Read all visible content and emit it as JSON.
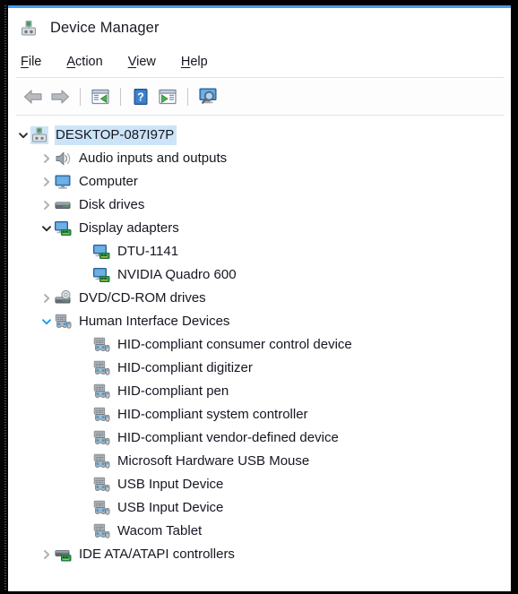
{
  "window": {
    "title": "Device Manager",
    "title_icon": "device-manager-icon",
    "accent_color": "#4a9ae8",
    "selection_color": "#cce4f7",
    "text_color": "#161622"
  },
  "menubar": {
    "items": [
      {
        "label": "File",
        "accel": "F",
        "name": "menu-file"
      },
      {
        "label": "Action",
        "accel": "A",
        "name": "menu-action"
      },
      {
        "label": "View",
        "accel": "V",
        "name": "menu-view"
      },
      {
        "label": "Help",
        "accel": "H",
        "name": "menu-help"
      }
    ]
  },
  "toolbar": {
    "buttons": [
      {
        "icon": "back-arrow-icon",
        "tooltip": "Back"
      },
      {
        "icon": "forward-arrow-icon",
        "tooltip": "Forward"
      },
      {
        "icon": "separator",
        "tooltip": ""
      },
      {
        "icon": "show-console-tree-icon",
        "tooltip": "Show/Hide console tree"
      },
      {
        "icon": "separator",
        "tooltip": ""
      },
      {
        "icon": "help-icon",
        "tooltip": "Help"
      },
      {
        "icon": "properties-icon",
        "tooltip": "Properties"
      },
      {
        "icon": "separator",
        "tooltip": ""
      },
      {
        "icon": "scan-hardware-icon",
        "tooltip": "Scan for hardware changes"
      }
    ]
  },
  "tree": {
    "rows": [
      {
        "label": "DESKTOP-087I97P",
        "level": 0,
        "chevron": "down",
        "chevron_color": "dark",
        "icon": "computer-root-icon",
        "selected": true,
        "name": "tree-item-desktop-087i97p"
      },
      {
        "label": "Audio inputs and outputs",
        "level": 1,
        "chevron": "right",
        "chevron_color": "gray",
        "icon": "speaker-icon",
        "selected": false,
        "name": "tree-item-audio-inputs-and-outputs"
      },
      {
        "label": "Computer",
        "level": 1,
        "chevron": "right",
        "chevron_color": "gray",
        "icon": "monitor-icon",
        "selected": false,
        "name": "tree-item-computer"
      },
      {
        "label": "Disk drives",
        "level": 1,
        "chevron": "right",
        "chevron_color": "gray",
        "icon": "disk-drive-icon",
        "selected": false,
        "name": "tree-item-disk-drives"
      },
      {
        "label": "Display adapters",
        "level": 1,
        "chevron": "down",
        "chevron_color": "dark",
        "icon": "display-adapter-icon",
        "selected": false,
        "name": "tree-item-display-adapters"
      },
      {
        "label": "DTU-1141",
        "level": 2,
        "chevron": "none",
        "chevron_color": "",
        "icon": "display-adapter-icon",
        "selected": false,
        "name": "tree-item-dtu-1141"
      },
      {
        "label": "NVIDIA Quadro 600",
        "level": 2,
        "chevron": "none",
        "chevron_color": "",
        "icon": "display-adapter-icon",
        "selected": false,
        "name": "tree-item-nvidia-quadro-600"
      },
      {
        "label": "DVD/CD-ROM drives",
        "level": 1,
        "chevron": "right",
        "chevron_color": "gray",
        "icon": "dvd-drive-icon",
        "selected": false,
        "name": "tree-item-dvd-cd-rom-drives"
      },
      {
        "label": "Human Interface Devices",
        "level": 1,
        "chevron": "down",
        "chevron_color": "blue",
        "icon": "hid-icon",
        "selected": false,
        "name": "tree-item-human-interface-devices"
      },
      {
        "label": "HID-compliant consumer control device",
        "level": 2,
        "chevron": "none",
        "chevron_color": "",
        "icon": "hid-icon",
        "selected": false,
        "name": "tree-item-hid-compliant-consumer-control-device"
      },
      {
        "label": "HID-compliant digitizer",
        "level": 2,
        "chevron": "none",
        "chevron_color": "",
        "icon": "hid-icon",
        "selected": false,
        "name": "tree-item-hid-compliant-digitizer"
      },
      {
        "label": "HID-compliant pen",
        "level": 2,
        "chevron": "none",
        "chevron_color": "",
        "icon": "hid-icon",
        "selected": false,
        "name": "tree-item-hid-compliant-pen"
      },
      {
        "label": "HID-compliant system controller",
        "level": 2,
        "chevron": "none",
        "chevron_color": "",
        "icon": "hid-icon",
        "selected": false,
        "name": "tree-item-hid-compliant-system-controller"
      },
      {
        "label": "HID-compliant vendor-defined device",
        "level": 2,
        "chevron": "none",
        "chevron_color": "",
        "icon": "hid-icon",
        "selected": false,
        "name": "tree-item-hid-compliant-vendor-defined-device"
      },
      {
        "label": "Microsoft Hardware USB Mouse",
        "level": 2,
        "chevron": "none",
        "chevron_color": "",
        "icon": "hid-icon",
        "selected": false,
        "name": "tree-item-microsoft-hardware-usb-mouse"
      },
      {
        "label": "USB Input Device",
        "level": 2,
        "chevron": "none",
        "chevron_color": "",
        "icon": "hid-icon",
        "selected": false,
        "name": "tree-item-usb-input-device-1"
      },
      {
        "label": "USB Input Device",
        "level": 2,
        "chevron": "none",
        "chevron_color": "",
        "icon": "hid-icon",
        "selected": false,
        "name": "tree-item-usb-input-device-2"
      },
      {
        "label": "Wacom Tablet",
        "level": 2,
        "chevron": "none",
        "chevron_color": "",
        "icon": "hid-icon",
        "selected": false,
        "name": "tree-item-wacom-tablet"
      },
      {
        "label": "IDE ATA/ATAPI controllers",
        "level": 1,
        "chevron": "right",
        "chevron_color": "gray",
        "icon": "ide-controller-icon",
        "selected": false,
        "name": "tree-item-ide-ata-atapi-controllers"
      }
    ]
  }
}
